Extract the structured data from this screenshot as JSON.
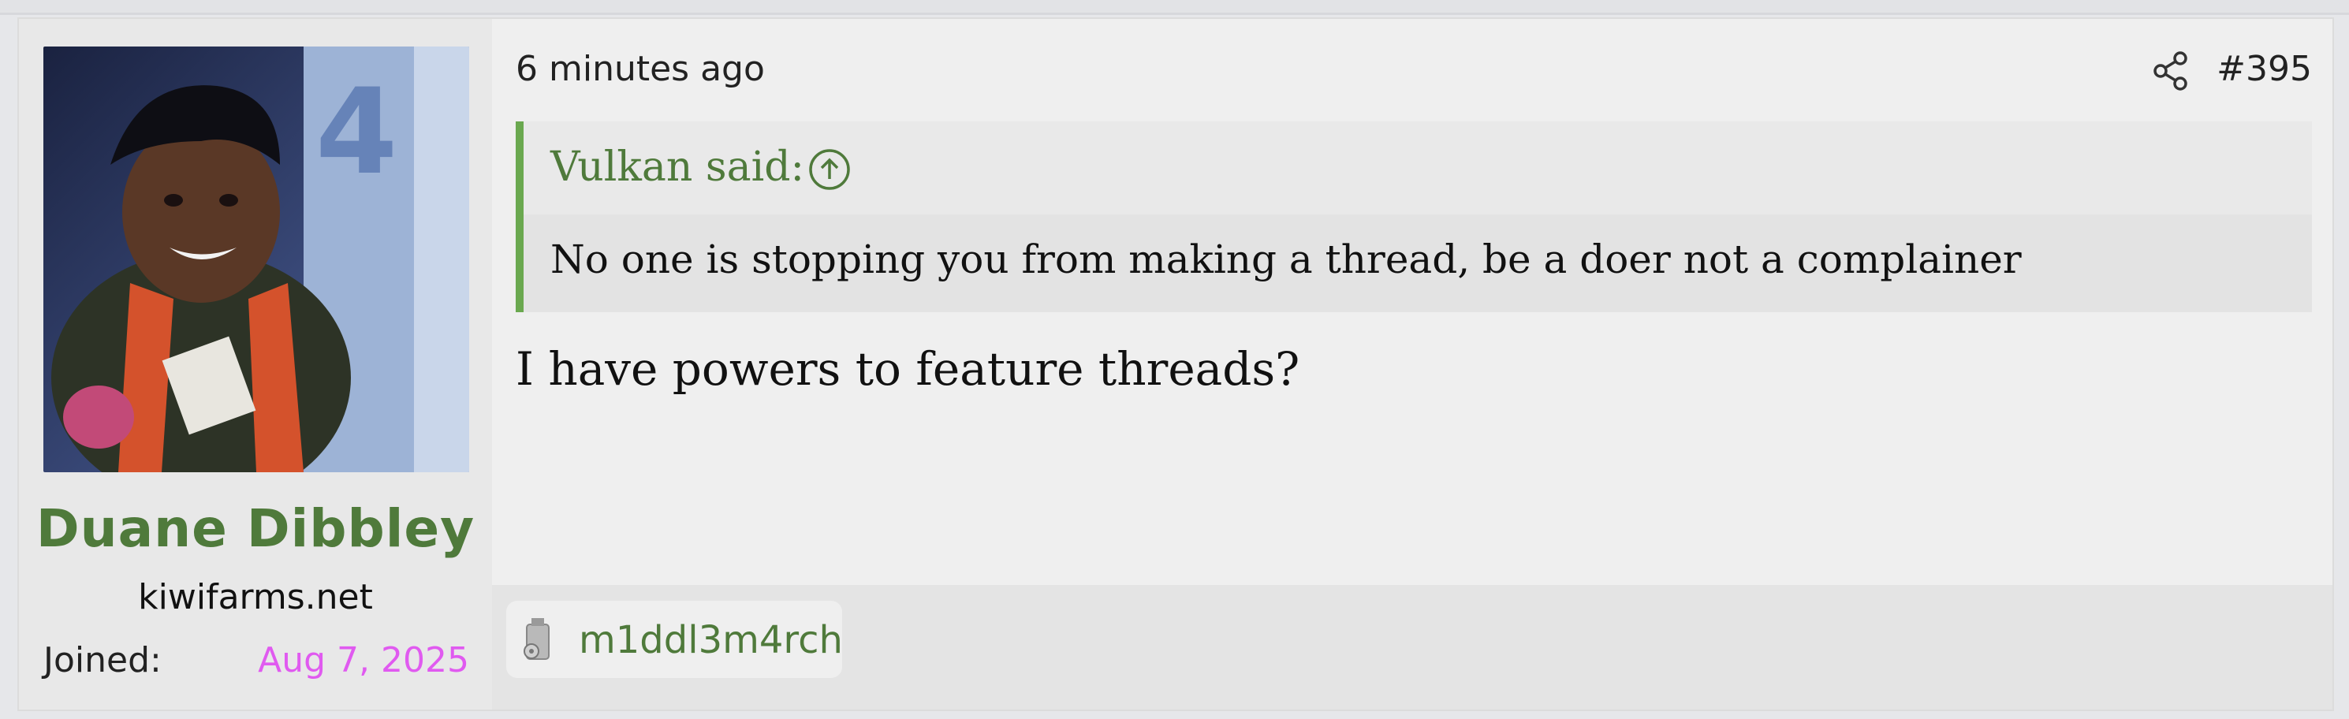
{
  "post": {
    "timestamp": "6 minutes ago",
    "post_number": "#395",
    "user": {
      "name": "Duane Dibbley",
      "title": "kiwifarms.net",
      "joined_label": "Joined:",
      "joined_date": "Aug 7, 2025"
    },
    "quote": {
      "author": "Vulkan said:",
      "text": "No one is stopping you from making a thread, be a doer not a complainer"
    },
    "message": "I have powers to feature threads?",
    "reaction": {
      "user": "m1ddl3m4rch"
    }
  },
  "colors": {
    "username": "#4f7a3b",
    "joined_date": "#e05af0",
    "quote_border": "#6aa84f"
  },
  "icons": [
    "share-icon",
    "quote-jump-arrow-icon",
    "reaction-trophy-icon"
  ]
}
